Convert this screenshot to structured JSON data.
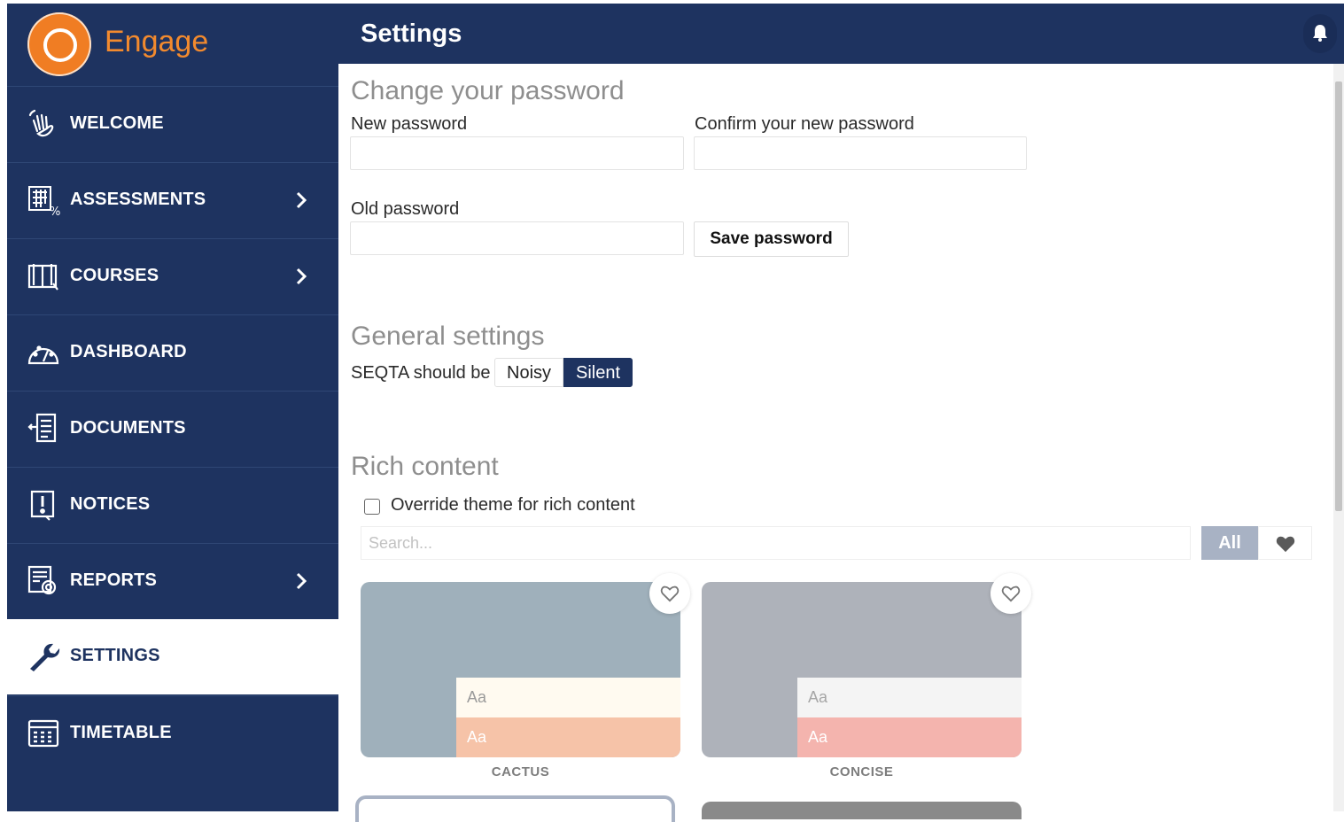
{
  "app": {
    "logo_text": "Engage",
    "accent_color": "#f07d23",
    "nav_color": "#1e3360"
  },
  "header": {
    "title": "Settings"
  },
  "sidebar": {
    "items": [
      {
        "label": "WELCOME",
        "icon": "wave-hand-icon",
        "has_submenu": false
      },
      {
        "label": "ASSESSMENTS",
        "icon": "assessments-icon",
        "has_submenu": true
      },
      {
        "label": "COURSES",
        "icon": "book-icon",
        "has_submenu": true
      },
      {
        "label": "DASHBOARD",
        "icon": "gauge-icon",
        "has_submenu": false
      },
      {
        "label": "DOCUMENTS",
        "icon": "document-icon",
        "has_submenu": false
      },
      {
        "label": "NOTICES",
        "icon": "notice-icon",
        "has_submenu": false
      },
      {
        "label": "REPORTS",
        "icon": "reports-icon",
        "has_submenu": true
      },
      {
        "label": "SETTINGS",
        "icon": "wrench-icon",
        "has_submenu": false,
        "active": true
      },
      {
        "label": "TIMETABLE",
        "icon": "calendar-icon",
        "has_submenu": false
      }
    ]
  },
  "password": {
    "section_title": "Change your password",
    "new_label": "New password",
    "confirm_label": "Confirm your new password",
    "old_label": "Old password",
    "new_value": "",
    "confirm_value": "",
    "old_value": "",
    "save_label": "Save password"
  },
  "general": {
    "section_title": "General settings",
    "seqta_label": "SEQTA should be",
    "options": [
      "Noisy",
      "Silent"
    ],
    "selected": "Silent"
  },
  "rich": {
    "section_title": "Rich content",
    "override_label": "Override theme for rich content",
    "override_checked": false,
    "search_placeholder": "Search...",
    "search_value": "",
    "filter_all_label": "All",
    "themes": [
      {
        "name": "CACTUS",
        "sample": "Aa",
        "colors": {
          "base": "#9fb0bb",
          "light": "#fffaf0",
          "accent": "#f6c3a8"
        }
      },
      {
        "name": "CONCISE",
        "sample": "Aa",
        "colors": {
          "base": "#aeb2ba",
          "light": "#f4f4f4",
          "accent": "#f4b4ae"
        }
      }
    ]
  }
}
